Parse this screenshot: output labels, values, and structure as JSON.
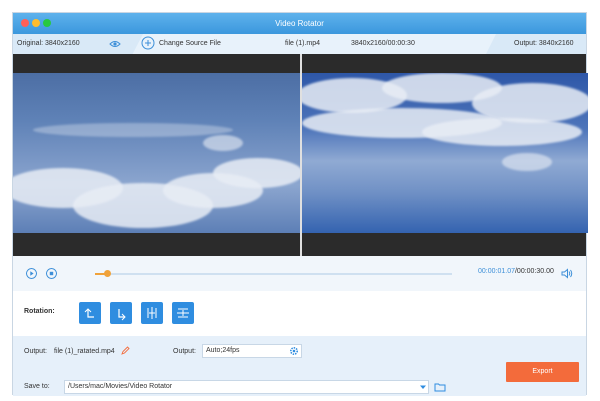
{
  "window": {
    "title": "Video Rotator"
  },
  "info": {
    "original": "Original: 3840x2160",
    "change_source": "Change Source File",
    "filename": "file (1).mp4",
    "meta": "3840x2160/00:00:30",
    "output": "Output: 3840x2160"
  },
  "player": {
    "current_time": "00:00:01.07",
    "total_time": "/00:00:30.00",
    "progress": 0.036
  },
  "rotation": {
    "label": "Rotation:",
    "buttons": [
      "rotate-left",
      "rotate-right",
      "flip-horizontal",
      "flip-vertical"
    ]
  },
  "output": {
    "label": "Output:",
    "filename": "file (1)_ratated.mp4",
    "format_label": "Output:",
    "format_value": "Auto;24fps",
    "save_label": "Save to:",
    "save_path": "/Users/mac/Movies/Video Rotator",
    "export_label": "Export"
  },
  "colors": {
    "accent": "#2f8de0",
    "export": "#f36b3b",
    "progress": "#f0a23a"
  }
}
